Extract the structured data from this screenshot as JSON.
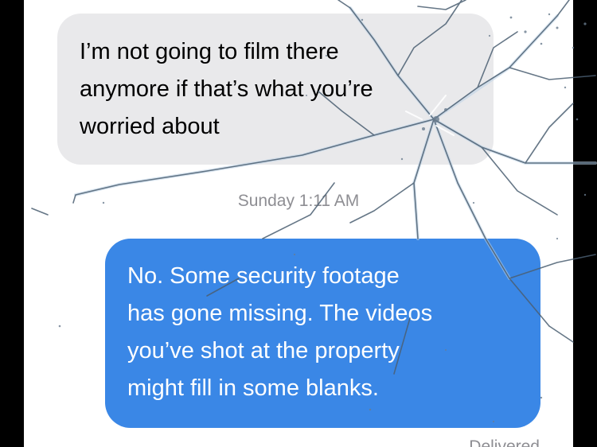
{
  "conversation": {
    "incoming_message": {
      "lines": [
        "I’m not going to film there",
        "anymore if that’s what you’re",
        "worried about"
      ]
    },
    "timestamp": "Sunday 1:11 AM",
    "outgoing_message": {
      "lines": [
        "No. Some security footage",
        "has gone missing. The videos",
        "you’ve shot at the property",
        "might fill in some blanks."
      ]
    },
    "delivery_status": "Delivered"
  },
  "colors": {
    "incoming_bubble": "#e9e9eb",
    "outgoing_bubble": "#3a87e6",
    "meta_text": "#8e8e93",
    "side_frame": "#000000"
  },
  "overlay": {
    "effect": "cracked-glass"
  }
}
